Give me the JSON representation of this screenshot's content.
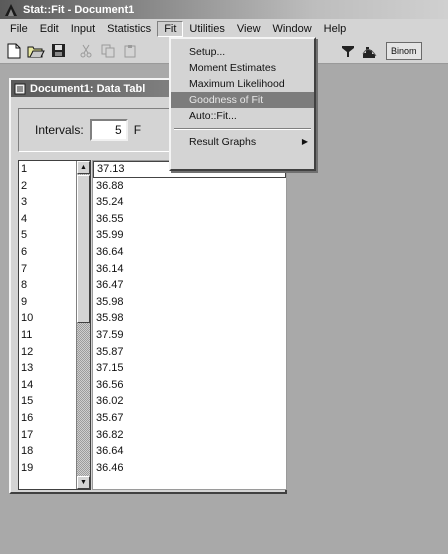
{
  "app": {
    "title": "Stat::Fit - Document1"
  },
  "menubar": {
    "items": [
      "File",
      "Edit",
      "Input",
      "Statistics",
      "Fit",
      "Utilities",
      "View",
      "Window",
      "Help"
    ]
  },
  "toolbar": {
    "binom_label": "Binom"
  },
  "fit_menu": {
    "items": [
      {
        "label": "Setup..."
      },
      {
        "label": "Moment Estimates"
      },
      {
        "label": "Maximum Likelihood"
      },
      {
        "label": "Goodness of Fit"
      },
      {
        "label": "Auto::Fit..."
      },
      {
        "label": "Result Graphs"
      }
    ],
    "highlighted": "Goodness of Fit"
  },
  "document": {
    "title": "Document1: Data Tabl",
    "intervals_label": "Intervals:",
    "intervals_value": "5",
    "next_label": "F",
    "row_ids": [
      "1",
      "2",
      "3",
      "4",
      "5",
      "6",
      "7",
      "8",
      "9",
      "10",
      "11",
      "12",
      "13",
      "14",
      "15",
      "16",
      "17",
      "18",
      "19"
    ],
    "values": [
      "37.13",
      "36.88",
      "35.24",
      "36.55",
      "35.99",
      "36.64",
      "36.14",
      "36.47",
      "35.98",
      "35.98",
      "37.59",
      "35.87",
      "37.15",
      "36.56",
      "36.02",
      "35.67",
      "36.82",
      "36.64",
      "36.46"
    ]
  }
}
